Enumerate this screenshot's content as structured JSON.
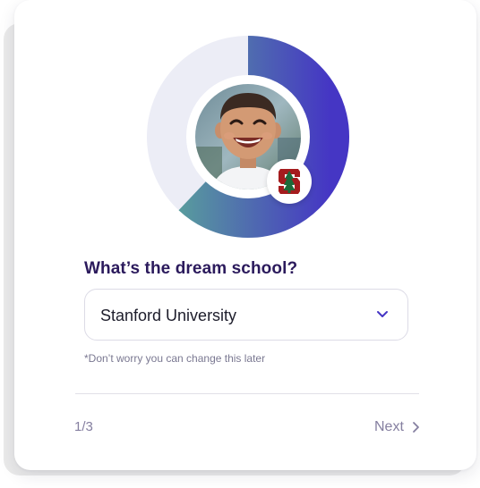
{
  "progress": {
    "fraction": 0.62,
    "track_color": "#ecedf6",
    "gradient_start": "#5aa49a",
    "gradient_end": "#4536c4"
  },
  "avatar": {
    "icon": "child-photo"
  },
  "school_badge": {
    "icon": "stanford-logo-icon",
    "letter": "S",
    "color": "#a51c1e"
  },
  "question": {
    "text": "What’s the dream school?"
  },
  "school_select": {
    "value": "Stanford University",
    "icon": "chevron-down-icon"
  },
  "hint": {
    "text": "*Don’t worry you can change this later"
  },
  "footer": {
    "step": "1/3",
    "next_label": "Next",
    "next_icon": "chevron-right-icon"
  },
  "colors": {
    "heading": "#2b1a5c",
    "muted": "#857fa0",
    "accent": "#4536c4"
  }
}
